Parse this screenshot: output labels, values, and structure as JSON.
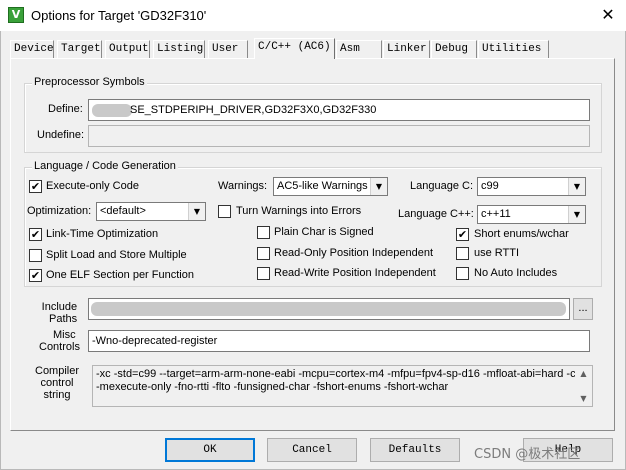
{
  "window": {
    "title": "Options for Target 'GD32F310'",
    "app_icon_glyph": "V",
    "close_glyph": "✕"
  },
  "tabs": [
    {
      "label": "Device"
    },
    {
      "label": "Target"
    },
    {
      "label": "Output"
    },
    {
      "label": "Listing"
    },
    {
      "label": "User"
    },
    {
      "label": "C/C++ (AC6)"
    },
    {
      "label": "Asm"
    },
    {
      "label": "Linker"
    },
    {
      "label": "Debug"
    },
    {
      "label": "Utilities"
    }
  ],
  "active_tab": "C/C++ (AC6)",
  "preprocessor": {
    "group_label": "Preprocessor Symbols",
    "define_label": "Define:",
    "define_value": "SE_STDPERIPH_DRIVER,GD32F3X0,GD32F330",
    "undefine_label": "Undefine:",
    "undefine_value": ""
  },
  "language": {
    "group_label": "Language / Code Generation",
    "execute_only": {
      "label": "Execute-only Code",
      "checked": true
    },
    "warnings_label": "Warnings:",
    "warnings_value": "AC5-like Warnings",
    "language_c_label": "Language C:",
    "language_c_value": "c99",
    "optimization_label": "Optimization:",
    "optimization_value": "<default>",
    "turn_warnings_errors": {
      "label": "Turn Warnings into Errors",
      "checked": false
    },
    "language_cpp_label": "Language C++:",
    "language_cpp_value": "c++11",
    "lto": {
      "label": "Link-Time Optimization",
      "checked": true
    },
    "plain_char_signed": {
      "label": "Plain Char is Signed",
      "checked": false
    },
    "short_enums": {
      "label": "Short enums/wchar",
      "checked": true
    },
    "split_load_store": {
      "label": "Split Load and Store Multiple",
      "checked": false
    },
    "ropi": {
      "label": "Read-Only Position Independent",
      "checked": false
    },
    "use_rtti": {
      "label": "use RTTI",
      "checked": false
    },
    "one_elf_section": {
      "label": "One ELF Section per Function",
      "checked": true
    },
    "rwpi": {
      "label": "Read-Write Position Independent",
      "checked": false
    },
    "no_auto_includes": {
      "label": "No Auto Includes",
      "checked": false
    }
  },
  "include_paths": {
    "label_line1": "Include",
    "label_line2": "Paths",
    "browse_label": "..."
  },
  "misc_controls": {
    "label_line1": "Misc",
    "label_line2": "Controls",
    "value": "-Wno-deprecated-register"
  },
  "compiler_control": {
    "label_line1": "Compiler",
    "label_line2": "control",
    "label_line3": "string",
    "line1": "-xc -std=c99 --target=arm-arm-none-eabi -mcpu=cortex-m4 -mfpu=fpv4-sp-d16 -mfloat-abi=hard -c",
    "line2": "-mexecute-only -fno-rtti -flto -funsigned-char -fshort-enums -fshort-wchar"
  },
  "buttons": {
    "ok": "OK",
    "cancel": "Cancel",
    "defaults": "Defaults",
    "help": "Help"
  },
  "watermark": "CSDN @极术社区",
  "check_glyph": "✔"
}
